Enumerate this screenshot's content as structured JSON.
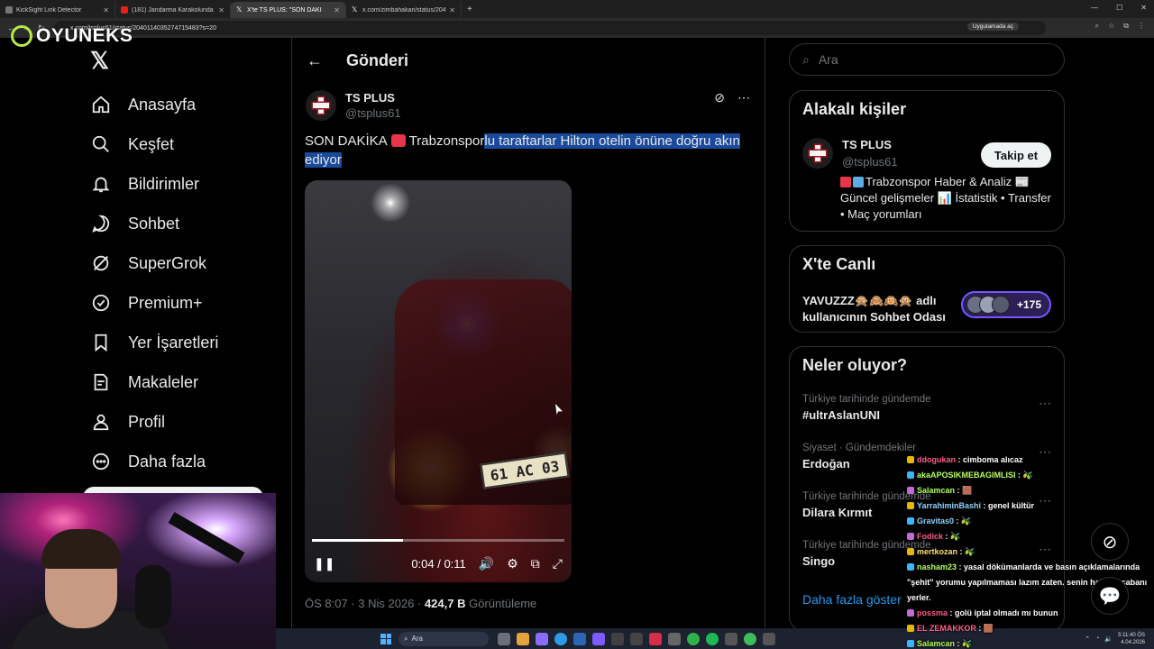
{
  "browser": {
    "tabs": [
      {
        "title": "KickSight Link Detector",
        "favicon": "generic"
      },
      {
        "title": "(181) Jandarma Karakolunda Ka",
        "favicon": "youtube"
      },
      {
        "title": "X'te TS PLUS: \"SON DAKİ",
        "favicon": "x",
        "active": true
      },
      {
        "title": "x.com/zimbahakan/status/204",
        "favicon": "x"
      }
    ],
    "url": "x.com/tsplus61/status/2040114035274715483?s=20",
    "app_button": "Uygulamada aç",
    "new_tab": "+"
  },
  "overlay": {
    "logo_text": "OYUNEKS"
  },
  "sidebar": {
    "items": [
      {
        "label": "Anasayfa",
        "icon": "home-icon"
      },
      {
        "label": "Keşfet",
        "icon": "search-icon"
      },
      {
        "label": "Bildirimler",
        "icon": "bell-icon"
      },
      {
        "label": "Sohbet",
        "icon": "chat-icon"
      },
      {
        "label": "SuperGrok",
        "icon": "grok-icon"
      },
      {
        "label": "Premium+",
        "icon": "verified-icon"
      },
      {
        "label": "Yer İşaretleri",
        "icon": "bookmark-icon"
      },
      {
        "label": "Makaleler",
        "icon": "article-icon"
      },
      {
        "label": "Profil",
        "icon": "profile-icon"
      },
      {
        "label": "Daha fazla",
        "icon": "more-icon"
      }
    ]
  },
  "main": {
    "header_title": "Gönderi",
    "author": {
      "name": "TS PLUS",
      "handle": "@tsplus61"
    },
    "text_before": "SON DAKİKA",
    "text_plain": "Trabzonspor",
    "text_selected": "lu taraftarlar Hilton otelin önüne doğru akın ediyor",
    "video": {
      "time": "0:04 / 0:11",
      "progress": 0.36,
      "plate": "61 AC 03"
    },
    "meta": {
      "time": "ÖS 8:07 · 3 Nis 2026 · ",
      "views": "424,7 B",
      "views_label": " Görüntüleme"
    }
  },
  "right": {
    "search_placeholder": "Ara",
    "related": {
      "title": "Alakalı kişiler",
      "name": "TS PLUS",
      "handle": "@tsplus61",
      "follow_label": "Takip et",
      "bio": "Trabzonspor Haber & Analiz 📰 Güncel gelişmeler 📊 İstatistik • Transfer • Maç yorumları"
    },
    "live": {
      "title": "X'te Canlı",
      "room": "YAVUZZZ🙊🙈🙉🙊 adlı kullanıcının Sohbet Odası",
      "count": "+175"
    },
    "trends": {
      "title": "Neler oluyor?",
      "items": [
        {
          "context": "Türkiye tarihinde gündemde",
          "topic": "#ultrAslanUNI"
        },
        {
          "context": "Siyaset · Gündemdekiler",
          "topic": "Erdoğan"
        },
        {
          "context": "Türkiye tarihinde gündemde",
          "topic": "Dilara Kırmıt"
        },
        {
          "context": "Türkiye tarihinde gündemde",
          "topic": "Singo"
        }
      ],
      "show_more": "Daha fazla göster"
    }
  },
  "chat": {
    "messages": [
      {
        "user": "ddogukan",
        "text": ": cimboma alıcaz",
        "color": "#ff5c8a"
      },
      {
        "user": "akaAPOSIKMEBAGIMLISI",
        "text": ": 🫒",
        "color": "#b6ff5c"
      },
      {
        "user": "Salamcan",
        "text": ": 🟫",
        "color": "#b6ff5c"
      },
      {
        "user": "YarrahiminBashi",
        "text": ": genel kültür",
        "color": "#8fd3ff"
      },
      {
        "user": "Gravitas0",
        "text": ": 🫒",
        "color": "#8fd3ff"
      },
      {
        "user": "Fodick",
        "text": ": 🫒",
        "color": "#ff5c8a"
      },
      {
        "user": "mertkozan",
        "text": ": 🫒",
        "color": "#ffe066"
      },
      {
        "user": "nasham23",
        "text": ": yasal dökümanlarda ve basın açıklamalarında \"şehit\" yorumu yapılmaması lazım zaten. senin hakaret çabanı yerler.",
        "color": "#b6ff5c"
      },
      {
        "user": "possma",
        "text": ": golü iptal olmadı mı bunun",
        "color": "#ff5c8a"
      },
      {
        "user": "EL ZEMAKKOR",
        "text": ": 🟫",
        "color": "#ff5c8a"
      },
      {
        "user": "Salamcan",
        "text": ": 🫒",
        "color": "#b6ff5c"
      }
    ]
  },
  "taskbar": {
    "search_label": "Ara",
    "clock_time": "5:11:40 ÖS",
    "clock_date": "4.04.2026"
  }
}
